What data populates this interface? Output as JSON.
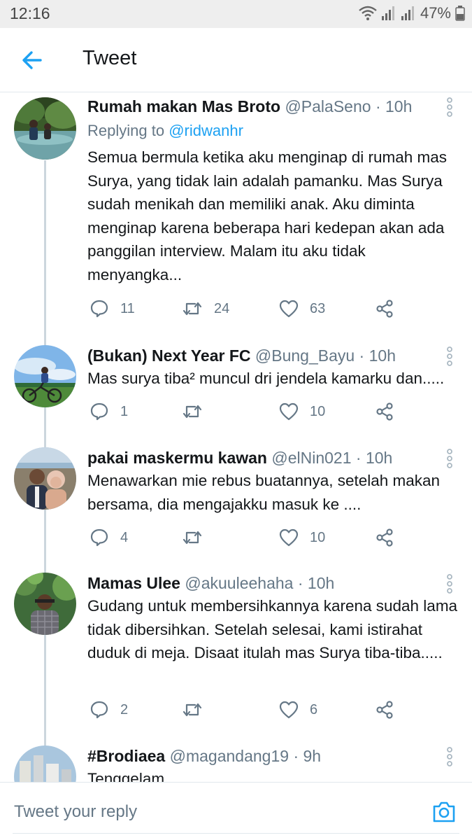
{
  "status_bar": {
    "time": "12:16",
    "battery": "47%"
  },
  "header": {
    "title": "Tweet"
  },
  "tweets": [
    {
      "name": "Rumah makan Mas Broto",
      "handle": "@PalaSeno",
      "dot": "·",
      "time": "10h",
      "replying_prefix": "Replying to",
      "replying_to": "@ridwanhr",
      "text": "Semua bermula ketika aku menginap di rumah mas Surya, yang tidak lain adalah pamanku. Mas Surya sudah menikah dan memiliki anak. Aku diminta menginap karena beberapa hari kedepan akan ada panggilan interview. Malam itu aku tidak menyangka...",
      "replies": "11",
      "retweets": "24",
      "likes": "63"
    },
    {
      "name": "(Bukan) Next Year FC",
      "handle": "@Bung_Bayu",
      "dot": "·",
      "time": "10h",
      "text": "Mas surya tiba² muncul dri jendela kamarku dan.....",
      "replies": "1",
      "retweets": "",
      "likes": "10"
    },
    {
      "name": "pakai maskermu kawan",
      "handle": "@elNin021",
      "dot": "·",
      "time": "10h",
      "text": "Menawarkan mie rebus buatannya, setelah makan bersama, dia mengajakku masuk ke ....",
      "replies": "4",
      "retweets": "",
      "likes": "10"
    },
    {
      "name": "Mamas Ulee",
      "handle": "@akuuleehaha",
      "dot": "·",
      "time": "10h",
      "text": "Gudang untuk membersihkannya karena sudah lama tidak dibersihkan. Setelah selesai, kami istirahat duduk di meja. Disaat itulah mas Surya tiba-tiba.....",
      "replies": "2",
      "retweets": "",
      "likes": "6"
    },
    {
      "name": "#Brodiaea",
      "handle": "@magandang19",
      "dot": "·",
      "time": "9h",
      "text": "Tenggelam"
    }
  ],
  "reply_bar": {
    "placeholder": "Tweet your reply"
  },
  "colors": {
    "accent": "#1da1f2",
    "secondary_text": "#657786",
    "divider": "#e1e8ed"
  },
  "icons": [
    "back-arrow-icon",
    "more-vertical-icon",
    "reply-icon",
    "retweet-icon",
    "like-icon",
    "share-icon",
    "camera-icon",
    "wifi-icon",
    "signal-icon",
    "battery-icon"
  ]
}
